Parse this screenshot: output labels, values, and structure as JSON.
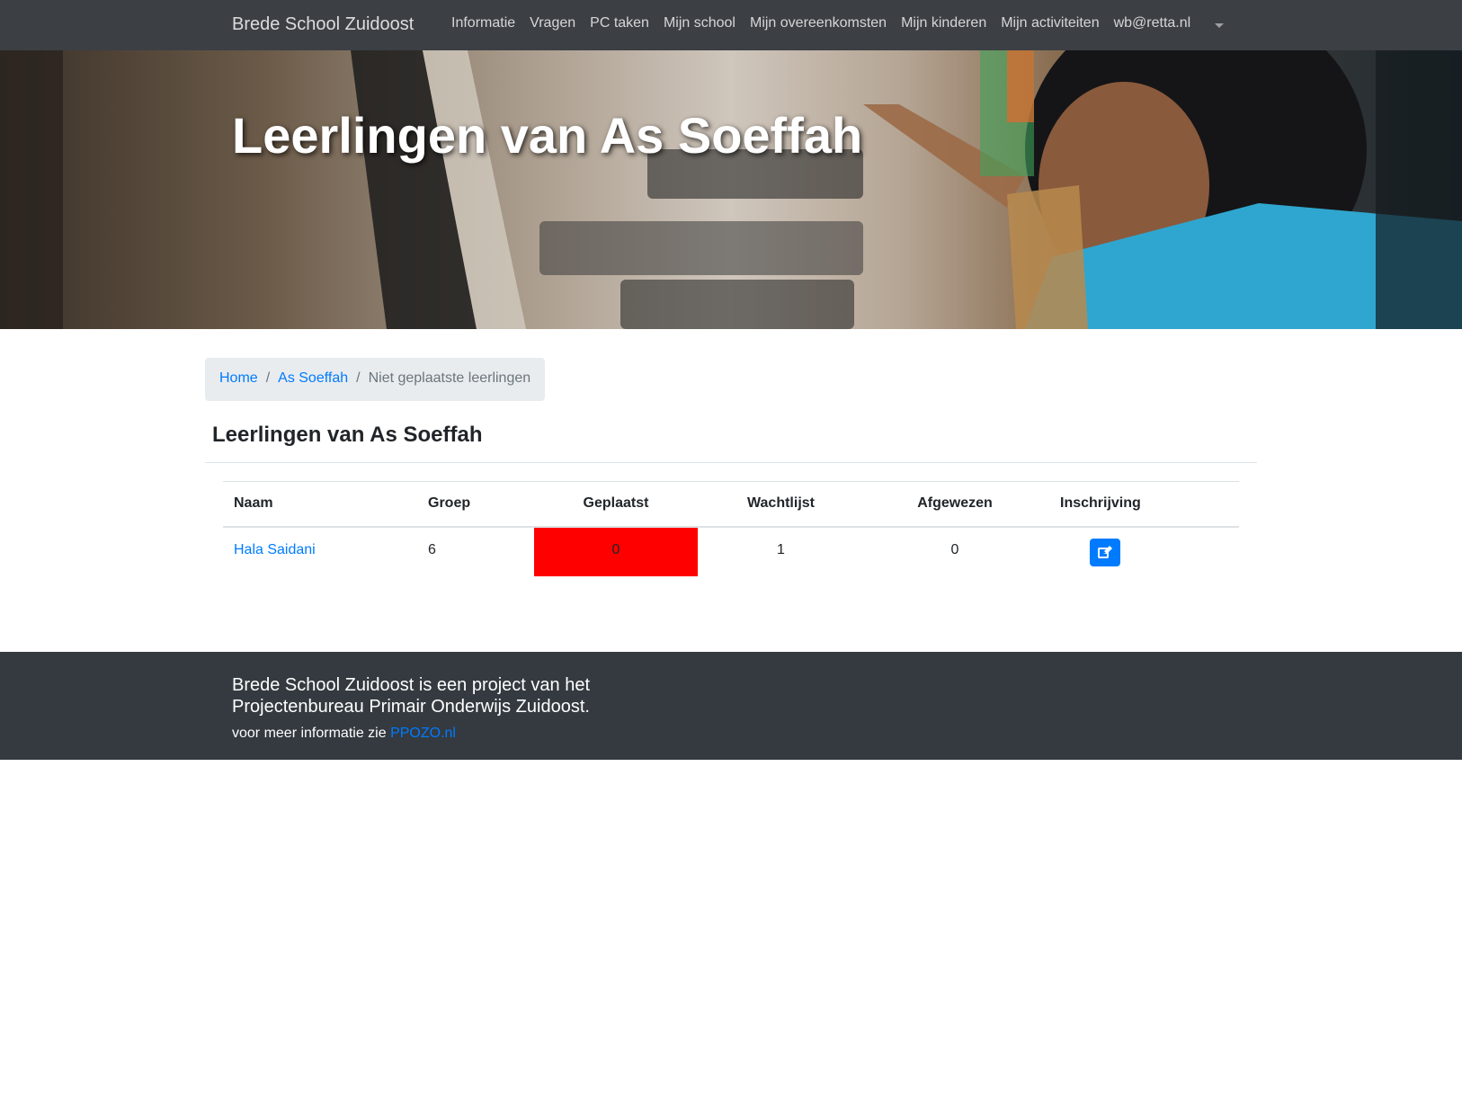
{
  "navbar": {
    "brand": "Brede School Zuidoost",
    "items": [
      {
        "label": "Informatie"
      },
      {
        "label": "Vragen"
      },
      {
        "label": "PC taken"
      },
      {
        "label": "Mijn school"
      },
      {
        "label": "Mijn overeenkomsten"
      },
      {
        "label": "Mijn kinderen"
      },
      {
        "label": "Mijn activiteiten"
      },
      {
        "label": "wb@retta.nl"
      }
    ]
  },
  "hero": {
    "title": "Leerlingen van As Soeffah"
  },
  "breadcrumb": {
    "home": "Home",
    "school": "As Soeffah",
    "current": "Niet geplaatste leerlingen",
    "separator": "/"
  },
  "section": {
    "title": "Leerlingen van As Soeffah"
  },
  "table": {
    "headers": {
      "naam": "Naam",
      "groep": "Groep",
      "geplaatst": "Geplaatst",
      "wachtlijst": "Wachtlijst",
      "afgewezen": "Afgewezen",
      "inschrijving": "Inschrijving"
    },
    "rows": [
      {
        "naam": "Hala Saidani",
        "groep": "6",
        "geplaatst": "0",
        "wachtlijst": "1",
        "afgewezen": "0",
        "inschrijving_icon": "edit-icon"
      }
    ]
  },
  "footer": {
    "lead": "Brede School Zuidoost is een project van het Projectenbureau Primair Onderwijs Zuidoost.",
    "more_prefix": "voor meer informatie zie",
    "link": "PPOZO.nl"
  },
  "colors": {
    "navbar_bg": "#34373c",
    "link": "#007bff",
    "footer_bg": "#343a40",
    "alert_cell": "#ff0000",
    "breadcrumb_bg": "#e9ecef"
  }
}
